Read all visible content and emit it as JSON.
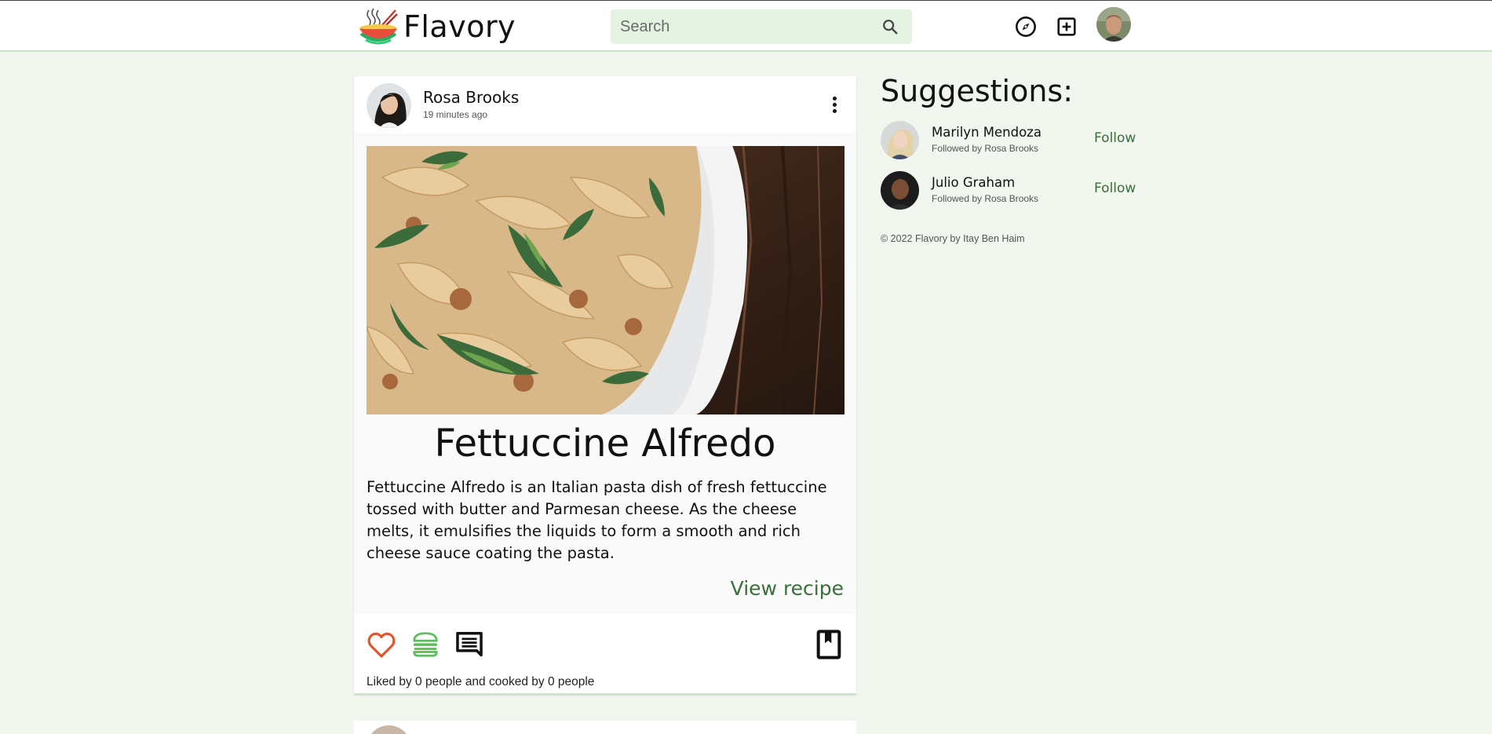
{
  "app": {
    "name": "Flavory"
  },
  "search": {
    "placeholder": "Search"
  },
  "post": {
    "author": "Rosa Brooks",
    "time": "19 minutes ago",
    "title": "Fettuccine Alfredo",
    "description": "Fettuccine Alfredo is an Italian pasta dish of fresh fettuccine tossed with butter and Parmesan cheese. As the cheese melts, it emulsifies the liquids to form a smooth and rich cheese sauce coating the pasta.",
    "view_recipe_label": "View recipe",
    "stats_text": "Liked by 0 people and cooked by 0 people"
  },
  "suggestions": {
    "title": "Suggestions:",
    "follow_label": "Follow",
    "items": [
      {
        "name": "Marilyn Mendoza",
        "followed_by": "Followed by Rosa Brooks"
      },
      {
        "name": "Julio Graham",
        "followed_by": "Followed by Rosa Brooks"
      }
    ]
  },
  "footer": {
    "copyright": "© 2022 Flavory by Itay Ben Haim"
  },
  "colors": {
    "accent_green": "#3a6f3a",
    "like_orange": "#e0552b",
    "cooked_green": "#5bbf5b",
    "background": "#f1f6ef",
    "search_bg": "#e4f3e1"
  },
  "icons": [
    "logo-bowl-icon",
    "search-icon",
    "explore-icon",
    "add-post-icon",
    "more-vert-icon",
    "heart-icon",
    "burger-icon",
    "comment-icon",
    "bookmark-icon"
  ]
}
